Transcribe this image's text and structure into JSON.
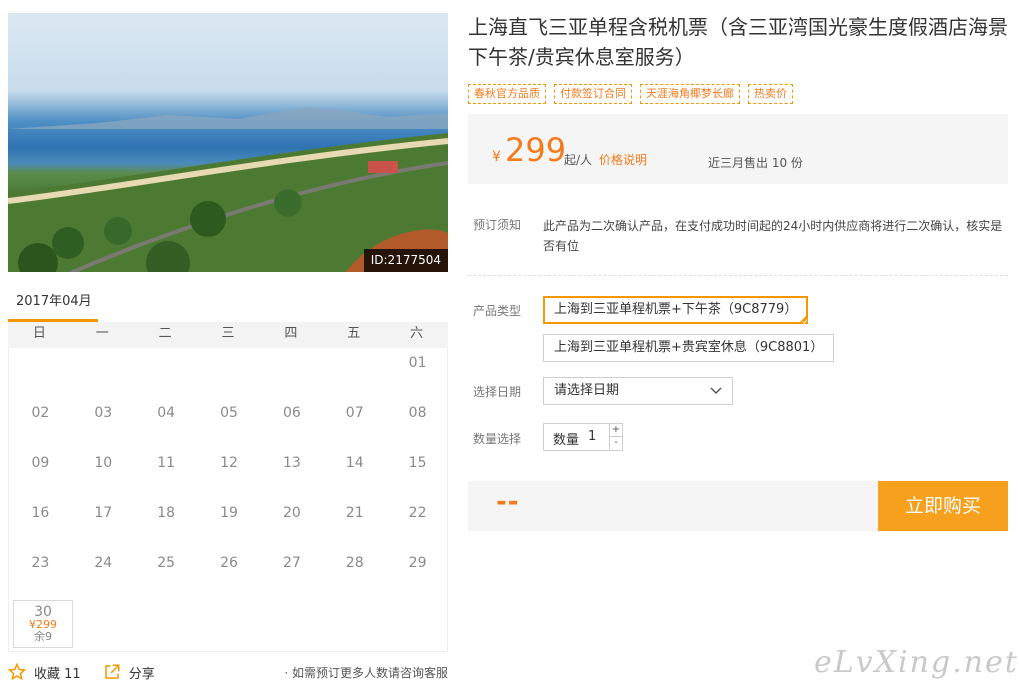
{
  "photo": {
    "id_label": "ID:2177504"
  },
  "product": {
    "title": "上海直飞三亚单程含税机票（含三亚湾国光豪生度假酒店海景下午茶/贵宾休息室服务）",
    "tags": [
      "春秋官方品质",
      "付款签订合同",
      "天涯海角椰梦长廊",
      "热卖价"
    ]
  },
  "price": {
    "currency": "¥",
    "amount": "299",
    "unit": "起/人",
    "explain_link": "价格说明",
    "sold_text": "近三月售出 10 份"
  },
  "notice": {
    "label": "预订须知",
    "text": "此产品为二次确认产品，在支付成功时间起的24小时内供应商将进行二次确认，核实是否有位"
  },
  "options": {
    "type_label": "产品类型",
    "types": [
      "上海到三亚单程机票+下午茶（9C8779）",
      "上海到三亚单程机票+贵宾室休息（9C8801）"
    ],
    "selected_index": 0,
    "date_label": "选择日期",
    "date_placeholder": "请选择日期",
    "qty_label": "数量选择",
    "qty_inner_label": "数量",
    "qty_value": "1",
    "plus": "+",
    "minus": "-"
  },
  "buy": {
    "total": "--",
    "button": "立即购买"
  },
  "calendar": {
    "month_label": "2017年04月",
    "weekdays": [
      "日",
      "一",
      "二",
      "三",
      "四",
      "五",
      "六"
    ],
    "days": [
      "01",
      "02",
      "03",
      "04",
      "05",
      "06",
      "07",
      "08",
      "09",
      "10",
      "11",
      "12",
      "13",
      "14",
      "15",
      "16",
      "17",
      "18",
      "19",
      "20",
      "21",
      "22",
      "23",
      "24",
      "25",
      "26",
      "27",
      "28",
      "29",
      "30"
    ],
    "first_weekday": 6,
    "available": {
      "day": "30",
      "price": "¥299",
      "stock": "余9"
    }
  },
  "footer": {
    "favorite_label": "收藏 11",
    "share_label": "分享",
    "consult_text": "· 如需预订更多人数请咨询客服"
  },
  "watermark": "eLvXing.net",
  "colors": {
    "accent": "#f37b1d",
    "button": "#f7a01e",
    "tag_border": "#f39800"
  }
}
